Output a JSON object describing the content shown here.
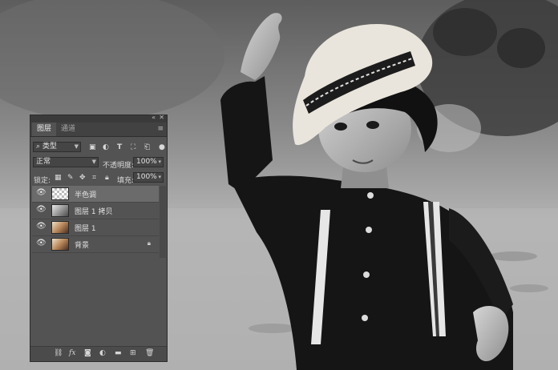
{
  "panel": {
    "collapse_icon": "«",
    "close_icon": "✕",
    "tabs": [
      {
        "label": "图层",
        "active": true
      },
      {
        "label": "通道",
        "active": false
      }
    ],
    "menu_icon": "≡",
    "filter": {
      "icon": "⌕",
      "label": "类型"
    },
    "blend_mode": "正常",
    "opacity_label": "不透明度:",
    "opacity_value": "100%",
    "lock_label": "锁定:",
    "fill_label": "填充:",
    "fill_value": "100%",
    "layers": [
      {
        "name": "半色调",
        "thumb": "checker",
        "selected": true,
        "locked": false
      },
      {
        "name": "图层 1 拷贝",
        "thumb": "gray",
        "selected": false,
        "locked": false
      },
      {
        "name": "图层 1",
        "thumb": "color",
        "selected": false,
        "locked": false
      },
      {
        "name": "背景",
        "thumb": "color",
        "selected": false,
        "locked": true
      }
    ],
    "bottom_fx": "fx"
  },
  "colors": {
    "panel_bg": "#535353",
    "selected_row": "#6b6b6b",
    "hat": "#e9e5dc",
    "shirt": "#161616"
  }
}
